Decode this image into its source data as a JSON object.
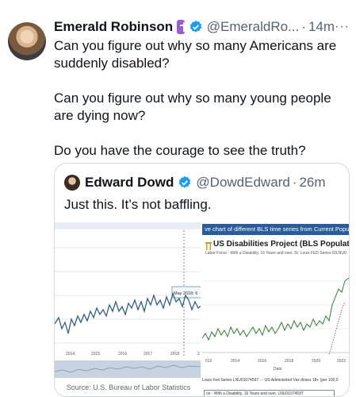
{
  "tweet": {
    "author_name": "Emerald Robinson",
    "handle": "@EmeraldRo...",
    "separator": "·",
    "time": "14m",
    "more": "···",
    "lines": [
      "Can you figure out why so many Americans are suddenly disabled?",
      "Can you figure out why so many young people are dying now?",
      "Do you have the courage to see the truth?"
    ]
  },
  "quote": {
    "author_name": "Edward Dowd",
    "handle": "@DowdEdward",
    "separator": "·",
    "time": "26m",
    "text": "Just this. It’s not baffling."
  },
  "media_left": {
    "tooltip": "May 2018: 6",
    "x_ticks": [
      "2014",
      "2015",
      "2016",
      "2017",
      "2018",
      "2"
    ],
    "source": "Source: U.S. Bureau of Labor Statistics"
  },
  "media_right": {
    "banner": "ve chart of different BLS time series from Current Populat",
    "title": "US Disabilities Project (BLS Population Survey",
    "subtitle": "Labor Force - With a Disability, 16 Years and over, St. Louis FED Series IDLNU0",
    "x_ticks": [
      "012",
      "2014",
      "2016",
      "2018",
      "2020",
      "2022"
    ],
    "x_label": "Date",
    "legend": "Louis Fed Series LNU01074597  - - US Administred Vax doses 18+ (per 100,0",
    "select": "ce - With a Disability, 16 Years and over, LNU01074597"
  },
  "colors": {
    "verified": "#1d9bf0",
    "secondary_text": "#536471",
    "border": "#cfd9de",
    "badge": "#9b5bd5",
    "banner": "#2a5b9a",
    "line_left": "#2f5f8a",
    "line_right": "#2e7d32"
  }
}
